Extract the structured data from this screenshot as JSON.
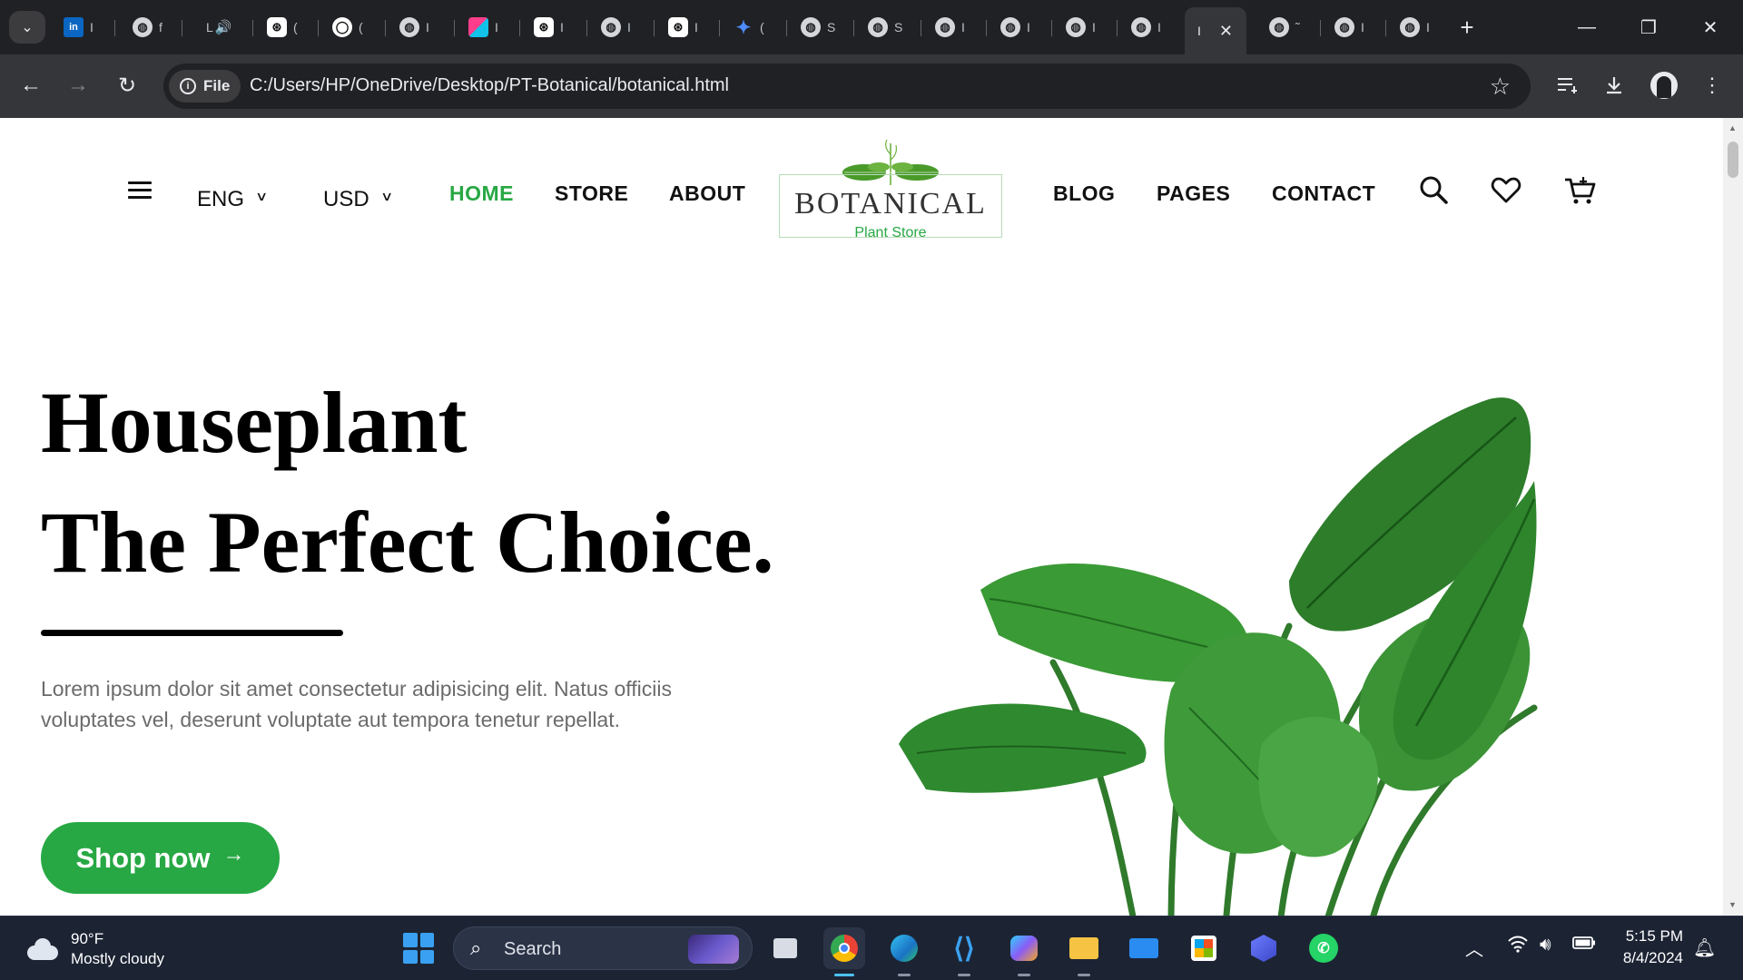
{
  "browser": {
    "tabs": [
      {
        "icon": "linkedin-icon",
        "label": "in",
        "chars": "I"
      },
      {
        "icon": "globe-icon",
        "label": "",
        "chars": "f"
      },
      {
        "icon": "audio-icon",
        "label": "L",
        "chars": "🔊"
      },
      {
        "icon": "chatgpt-icon",
        "label": "⊛",
        "chars": "("
      },
      {
        "icon": "github-icon",
        "label": "◯",
        "chars": "("
      },
      {
        "icon": "globe-icon",
        "label": "",
        "chars": "I"
      },
      {
        "icon": "cube-icon",
        "label": "",
        "chars": "I"
      },
      {
        "icon": "chatgpt-icon",
        "label": "⊛",
        "chars": "I"
      },
      {
        "icon": "globe-icon",
        "label": "",
        "chars": "I"
      },
      {
        "icon": "chatgpt-icon",
        "label": "⊛",
        "chars": "I"
      },
      {
        "icon": "gemini-icon",
        "label": "✦",
        "chars": "("
      },
      {
        "icon": "globe-icon",
        "label": "",
        "chars": "S"
      },
      {
        "icon": "globe-icon",
        "label": "",
        "chars": "S"
      },
      {
        "icon": "globe-icon",
        "label": "",
        "chars": "I"
      },
      {
        "icon": "globe-icon",
        "label": "",
        "chars": "I"
      },
      {
        "icon": "globe-icon",
        "label": "",
        "chars": "I"
      },
      {
        "icon": "globe-icon",
        "label": "",
        "chars": "I"
      }
    ],
    "active_tab": {
      "chars": "I",
      "close": "✕"
    },
    "after_tabs": [
      {
        "icon": "globe-icon",
        "chars": "˜"
      },
      {
        "icon": "globe-icon",
        "chars": "I"
      },
      {
        "icon": "globe-icon",
        "chars": "I"
      }
    ],
    "new_tab": "+",
    "window_controls": {
      "minimize": "—",
      "restore": "❐",
      "close": "✕"
    },
    "back": "←",
    "forward": "→",
    "reload": "↻",
    "chip_label": "File",
    "url": "C:/Users/HP/OneDrive/Desktop/PT-Botanical/botanical.html",
    "bookmark_star": "☆"
  },
  "site": {
    "lang": "ENG",
    "currency": "USD",
    "nav_left": [
      "HOME",
      "STORE",
      "ABOUT"
    ],
    "nav_right": [
      "BLOG",
      "PAGES",
      "CONTACT"
    ],
    "active_nav": "HOME",
    "logo": {
      "brand": "BOTANICAL",
      "tagline": "Plant Store"
    },
    "hero": {
      "title_line1": "Houseplant",
      "title_line2": "The Perfect Choice.",
      "text": "Lorem ipsum dolor sit amet consectetur adipisicing elit. Natus officiis voluptates vel, deserunt voluptate aut tempora tenetur repellat.",
      "button": "Shop now",
      "button_arrow": "→"
    },
    "colors": {
      "accent": "#27a844",
      "text": "#000000",
      "muted": "#6b6b6b"
    }
  },
  "taskbar": {
    "weather_temp": "90°F",
    "weather_cond": "Mostly cloudy",
    "search_label": "Search",
    "apps": [
      "file-manager-icon",
      "chrome-icon",
      "edge-icon",
      "vscode-icon",
      "copilot-icon",
      "explorer-icon",
      "mail-icon",
      "store-icon",
      "app-icon",
      "whatsapp-icon"
    ],
    "time": "5:15 PM",
    "date": "8/4/2024"
  }
}
